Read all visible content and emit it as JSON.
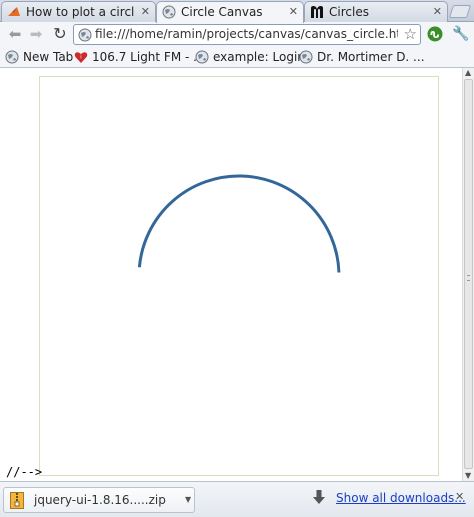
{
  "tabs": [
    {
      "label": "How to plot a circle - ",
      "icon": "matlab-icon",
      "active": false
    },
    {
      "label": "Circle Canvas",
      "icon": "globe-icon",
      "active": true
    },
    {
      "label": "Circles",
      "icon": "mathworld-icon",
      "active": false
    }
  ],
  "toolbar": {
    "url": "file:///home/ramin/projects/canvas/canvas_circle.html"
  },
  "bookmarks": [
    {
      "label": "New Tab",
      "icon": "globe-icon"
    },
    {
      "label": "106.7 Light FM - ...",
      "icon": "iheart-icon"
    },
    {
      "label": "example: Login",
      "icon": "globe-icon"
    },
    {
      "label": "Dr. Mortimer D. ...",
      "icon": "globe-icon"
    }
  ],
  "page": {
    "trailing_text": "//-->",
    "arc": {
      "stroke_color": "#336699",
      "start_angle_deg": 185,
      "end_angle_deg": 358,
      "direction": "clockwise"
    }
  },
  "downloads": {
    "filename": "jquery-ui-1.8.16.....zip",
    "show_all_label": "Show all downloads..."
  },
  "colors": {
    "canvas_border": "#d3e3b8",
    "link": "#1a3fc4"
  }
}
